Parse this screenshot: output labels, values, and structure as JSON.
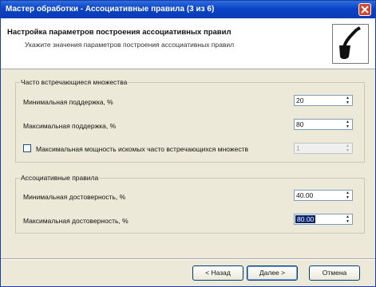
{
  "window": {
    "title": "Мастер обработки - Ассоциативные правила (3 из 6)"
  },
  "header": {
    "title": "Настройка параметров построения ассоциативных правил",
    "subtitle": "Укажите значения параметров построения ассоциативных правил"
  },
  "frequent_sets": {
    "legend": "Часто встречающиеся множества",
    "min_support_label": "Минимальная поддержка, %",
    "min_support_value": "20",
    "max_support_label": "Максимальная поддержка, %",
    "max_support_value": "80",
    "max_power_label": "Максимальная мощность искомых часто встречающихся множеств",
    "max_power_checked": false,
    "max_power_value": "1"
  },
  "assoc_rules": {
    "legend": "Ассоциативные правила",
    "min_conf_label": "Минимальная достоверность, %",
    "min_conf_value": "40.00",
    "max_conf_label": "Максимальная достоверность, %",
    "max_conf_value": "80.00"
  },
  "buttons": {
    "back": "< Назад",
    "next": "Далее >",
    "cancel": "Отмена"
  }
}
